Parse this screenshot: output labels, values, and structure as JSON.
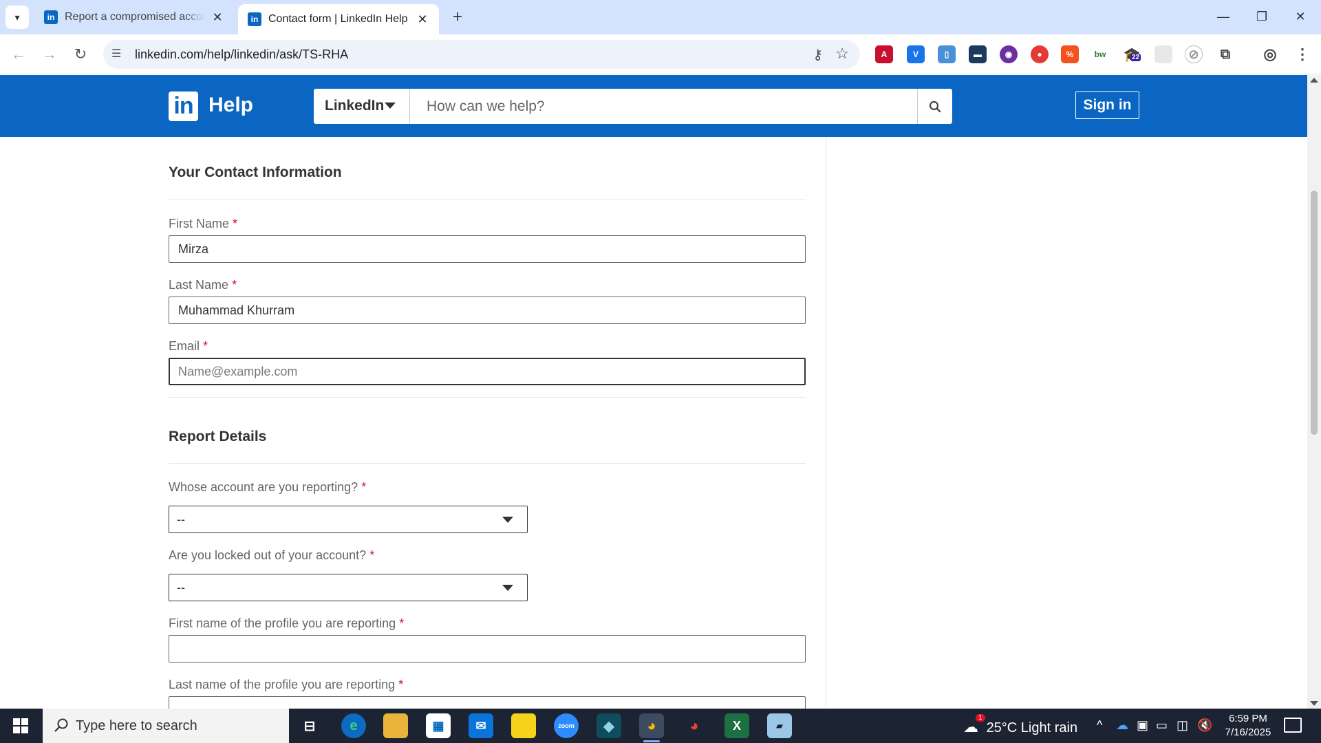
{
  "browser": {
    "tabs": [
      {
        "title": "Report a compromised account",
        "active": false
      },
      {
        "title": "Contact form | LinkedIn Help",
        "active": true
      }
    ],
    "url": "linkedin.com/help/linkedin/ask/TS-RHA",
    "extension_badge": "22"
  },
  "header": {
    "logo_mark": "in",
    "logo_text": "Help",
    "scope": "LinkedIn",
    "search_placeholder": "How can we help?",
    "signin_label": "Sign in"
  },
  "contact": {
    "title": "Your Contact Information",
    "first_name": {
      "label": "First Name",
      "value": "Mirza"
    },
    "last_name": {
      "label": "Last Name",
      "value": "Muhammad Khurram"
    },
    "email": {
      "label": "Email",
      "placeholder": "Name@example.com"
    }
  },
  "report": {
    "title": "Report Details",
    "whose_account": {
      "label": "Whose account are you reporting?",
      "value": "--"
    },
    "locked_out": {
      "label": "Are you locked out of your account?",
      "value": "--"
    },
    "profile_first": {
      "label": "First name of the profile you are reporting"
    },
    "profile_last": {
      "label": "Last name of the profile you are reporting"
    }
  },
  "required_mark": "*",
  "taskbar": {
    "search_placeholder": "Type here to search",
    "weather": "25°C  Light rain",
    "weather_alert": "1",
    "time": "6:59 PM",
    "date": "7/16/2025"
  },
  "colors": {
    "brand": "#0a66c2",
    "required": "#d11124"
  }
}
